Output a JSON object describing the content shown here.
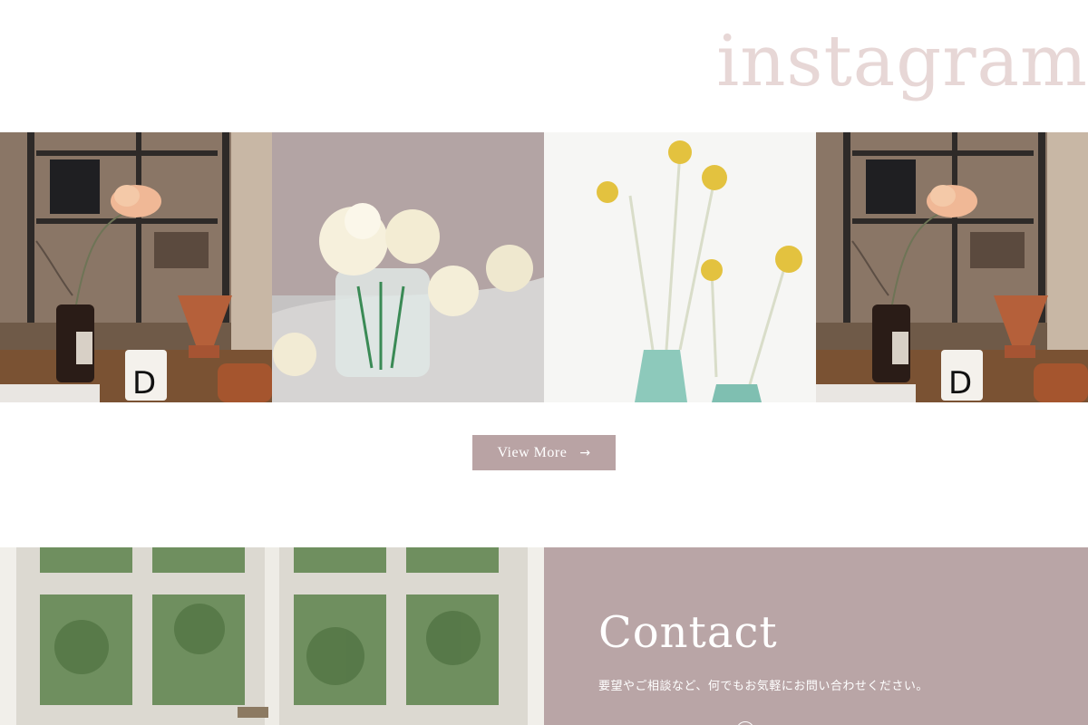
{
  "instagram": {
    "heading": "instagram",
    "photos": [
      {
        "alt": "cafe-table-with-flower"
      },
      {
        "alt": "white-flowers-in-jar"
      },
      {
        "alt": "yellow-billy-buttons"
      },
      {
        "alt": "cafe-table-with-flower"
      }
    ],
    "view_more_label": "View More",
    "view_more_arrow": "→"
  },
  "contact": {
    "title": "Contact",
    "description": "要望やご相談など、何でもお気軽にお問い合わせください。"
  },
  "colors": {
    "heading": "#e7d7d6",
    "accent": "#b9a3a4",
    "panel": "#b9a5a6"
  }
}
